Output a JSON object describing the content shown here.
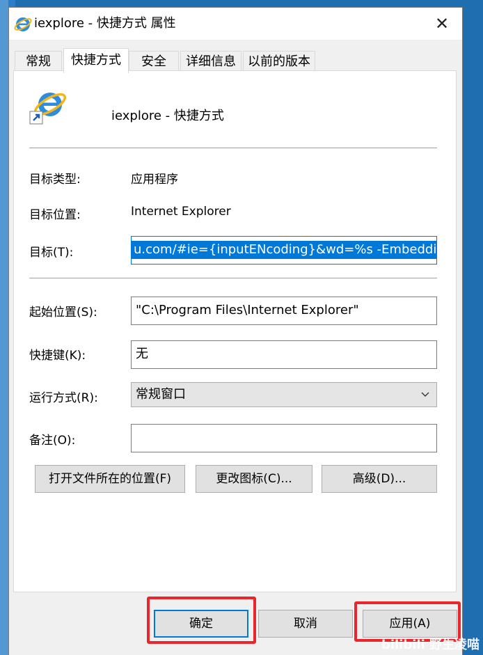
{
  "window": {
    "title": "iexplore - 快捷方式 属性",
    "close_glyph": "✕"
  },
  "tabs": [
    {
      "label": "常规",
      "active": false
    },
    {
      "label": "快捷方式",
      "active": true
    },
    {
      "label": "安全",
      "active": false
    },
    {
      "label": "详细信息",
      "active": false
    },
    {
      "label": "以前的版本",
      "active": false
    }
  ],
  "shortcut": {
    "name": "iexplore - 快捷方式",
    "icon": "internet-explorer-icon"
  },
  "fields": {
    "target_type_label": "目标类型:",
    "target_type_value": "应用程序",
    "target_location_label": "目标位置:",
    "target_location_value": "Internet Explorer",
    "target_label": "目标(T):",
    "target_value": "u.com/#ie={inputENcoding}&wd=%s -Embedding",
    "start_in_label": "起始位置(S):",
    "start_in_value": "\"C:\\Program Files\\Internet Explorer\"",
    "hotkey_label": "快捷键(K):",
    "hotkey_value": "无",
    "run_label": "运行方式(R):",
    "run_value": "常规窗口",
    "comment_label": "备注(O):",
    "comment_value": ""
  },
  "actions": {
    "open_location": "打开文件所在的位置(F)",
    "change_icon": "更改图标(C)...",
    "advanced": "高级(D)..."
  },
  "footer": {
    "ok": "确定",
    "cancel": "取消",
    "apply": "应用(A)"
  },
  "colors": {
    "accent": "#0078d7",
    "highlight_box": "#e8262c"
  },
  "watermark": {
    "text": "bilibili 野生凌喵"
  }
}
